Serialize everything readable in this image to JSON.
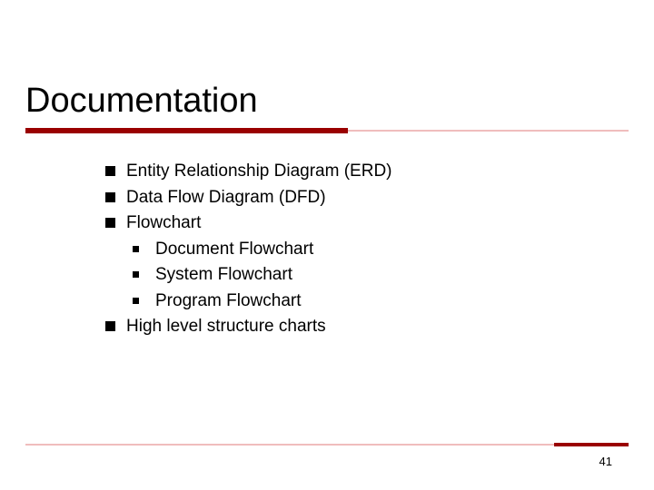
{
  "slide": {
    "title": "Documentation",
    "bullets": [
      {
        "text": "Entity Relationship Diagram (ERD)"
      },
      {
        "text": "Data Flow Diagram (DFD)"
      },
      {
        "text": "Flowchart",
        "sub": [
          "Document Flowchart",
          "System Flowchart",
          "Program Flowchart"
        ]
      },
      {
        "text": "High level structure charts"
      }
    ],
    "page_number": "41"
  }
}
